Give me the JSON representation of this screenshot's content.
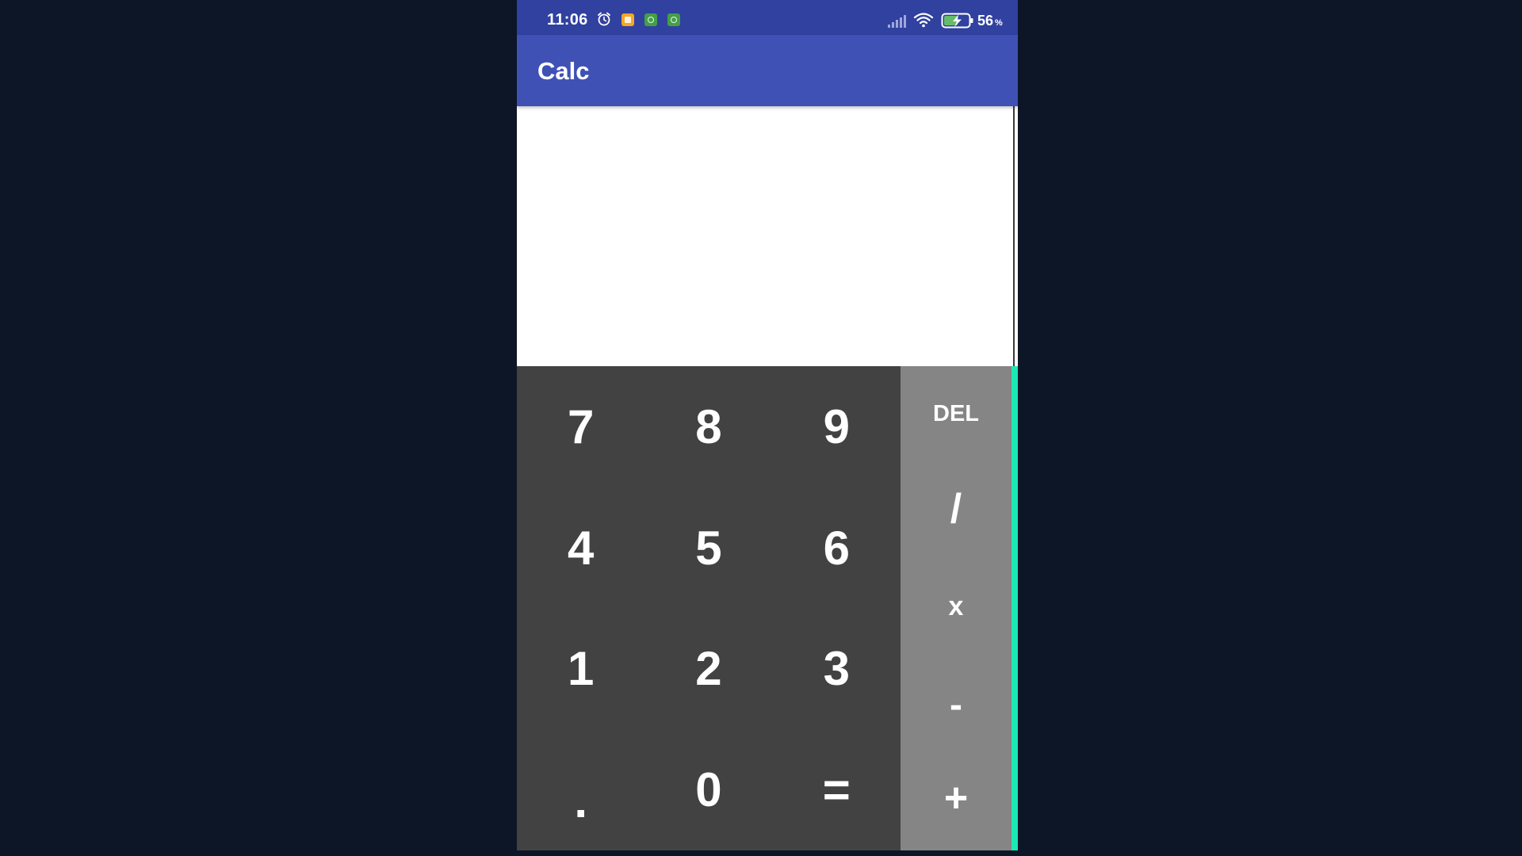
{
  "status_bar": {
    "time": "11:06",
    "battery_percent": "56",
    "battery_unit": "%",
    "icons": [
      "alarm-icon",
      "orange-notification-icon",
      "green-notification-icon",
      "green-notification-icon",
      "signal-icon",
      "wifi-icon",
      "battery-charging-icon"
    ]
  },
  "app_bar": {
    "title": "Calc"
  },
  "display": {
    "value": ""
  },
  "keypad": {
    "numbers": [
      "7",
      "8",
      "9",
      "4",
      "5",
      "6",
      "1",
      "2",
      "3",
      ".",
      "0",
      "="
    ],
    "operators": {
      "delete": "DEL",
      "divide": "/",
      "multiply": "x",
      "subtract": "-",
      "add": "+"
    }
  },
  "colors": {
    "status_bar": "#3141a0",
    "app_bar": "#3f51b5",
    "numpad": "#424242",
    "operator_pad": "#858585",
    "accent_edge": "#1de9b6",
    "background": "#0c1626"
  }
}
